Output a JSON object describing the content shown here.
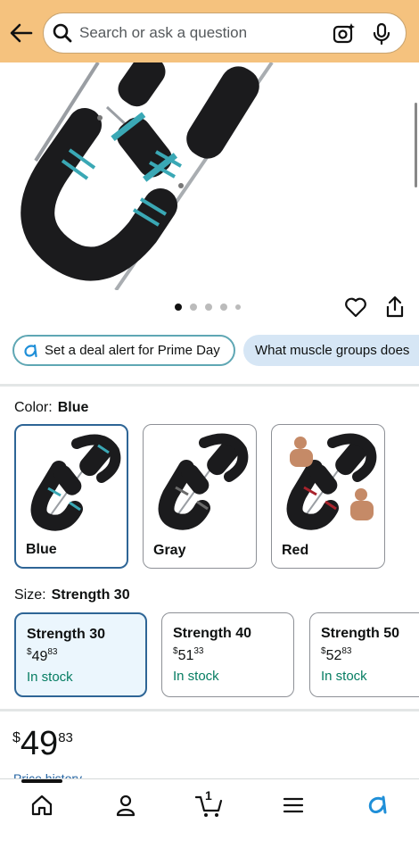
{
  "header": {
    "search_placeholder": "Search or ask a question"
  },
  "icons": {
    "back": "arrow-left",
    "search": "magnifier",
    "lens": "camera-sparkle",
    "mic": "microphone",
    "wishlist": "heart-outline",
    "share": "share-upload"
  },
  "carousel": {
    "dot_count": 5,
    "active_index": 0
  },
  "chips": {
    "deal_alert": "Set a deal alert for Prime Day",
    "question": "What muscle groups does"
  },
  "color": {
    "label": "Color:",
    "selected": "Blue",
    "options": [
      {
        "label": "Blue",
        "accent": "#3aa8b5",
        "selected": true
      },
      {
        "label": "Gray",
        "accent": "#6b6b6b",
        "selected": false
      },
      {
        "label": "Red",
        "accent": "#a8232c",
        "selected": false
      }
    ]
  },
  "size": {
    "label": "Size:",
    "selected": "Strength 30",
    "options": [
      {
        "name": "Strength 30",
        "price_symbol": "$",
        "price_whole": "49",
        "price_fraction": "83",
        "stock": "In stock",
        "selected": true
      },
      {
        "name": "Strength 40",
        "price_symbol": "$",
        "price_whole": "51",
        "price_fraction": "33",
        "stock": "In stock",
        "selected": false
      },
      {
        "name": "Strength 50",
        "price_symbol": "$",
        "price_whole": "52",
        "price_fraction": "83",
        "stock": "In stock",
        "selected": false
      }
    ]
  },
  "price": {
    "symbol": "$",
    "whole": "49",
    "fraction": "83",
    "history_link": "Price history"
  },
  "nav": {
    "cart_count": "1",
    "items": [
      "home",
      "account",
      "cart",
      "menu",
      "rufus"
    ]
  },
  "colors": {
    "header_bg": "#f5c27e",
    "selected_border": "#2e6596",
    "selected_bg": "#ebf6fd",
    "stock_green": "#067d62",
    "link_blue": "#2162a1",
    "rufus_blue": "#1f8fd8"
  }
}
